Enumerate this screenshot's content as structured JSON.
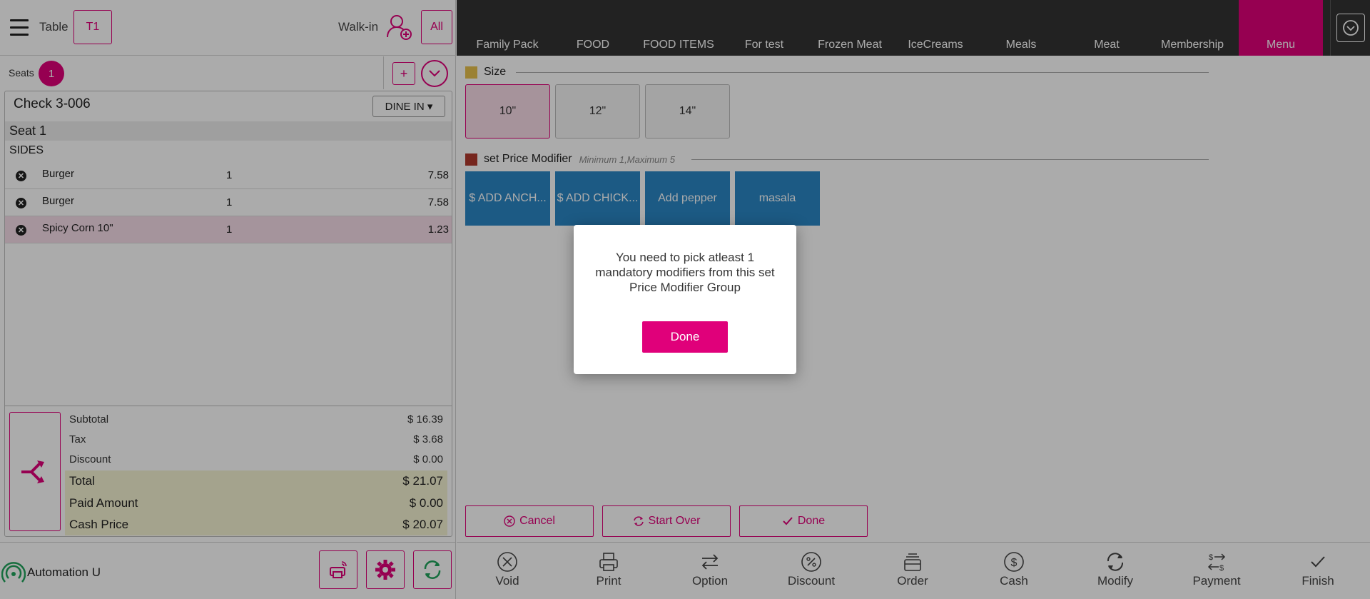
{
  "header": {
    "table_label": "Table",
    "table_value": "T1",
    "walkin_label": "Walk-in",
    "all_label": "All"
  },
  "seats": {
    "label": "Seats",
    "count": "1",
    "add_label": "+"
  },
  "check": {
    "title": "Check 3-006",
    "order_type": "DINE IN ▾",
    "seat_label": "Seat 1",
    "section_label": "SIDES",
    "items": [
      {
        "name": "Burger",
        "qty": "1",
        "price": "7.58"
      },
      {
        "name": "Burger",
        "qty": "1",
        "price": "7.58"
      },
      {
        "name": "Spicy Corn 10\"",
        "qty": "1",
        "price": "1.23"
      }
    ]
  },
  "totals": {
    "subtotal_label": "Subtotal",
    "subtotal": "$ 16.39",
    "tax_label": "Tax",
    "tax": "$ 3.68",
    "discount_label": "Discount",
    "discount": "$ 0.00",
    "total_label": "Total",
    "total": "$ 21.07",
    "paid_label": "Paid Amount",
    "paid": "$ 0.00",
    "cash_label": "Cash Price",
    "cash": "$ 20.07"
  },
  "user": {
    "name": "Automation U"
  },
  "categories": [
    "Family Pack",
    "FOOD",
    "FOOD ITEMS",
    "For test",
    "Frozen Meat",
    "IceCreams",
    "Meals",
    "Meat",
    "Membership",
    "Menu"
  ],
  "modifier_groups": {
    "size": {
      "name": "Size",
      "color": "#e8c14d",
      "options": [
        "10\"",
        "12\"",
        "14\""
      ]
    },
    "price": {
      "name": "set Price Modifier",
      "note": "Minimum 1,Maximum 5",
      "color": "#b03a2e",
      "options": [
        "$ ADD ANCH...",
        "$ ADD CHICK...",
        "Add pepper",
        "masala"
      ]
    }
  },
  "actions": {
    "cancel": "Cancel",
    "start_over": "Start Over",
    "done": "Done"
  },
  "bottom_nav": [
    "Void",
    "Print",
    "Option",
    "Discount",
    "Order",
    "Cash",
    "Modify",
    "Payment",
    "Finish"
  ],
  "dialog": {
    "message": "You need to pick atleast 1 mandatory modifiers from this set Price Modifier Group",
    "button": "Done"
  },
  "colors": {
    "accent": "#e0007a",
    "modifier_blue": "#2b86c5",
    "topbar_dark": "#333333"
  }
}
